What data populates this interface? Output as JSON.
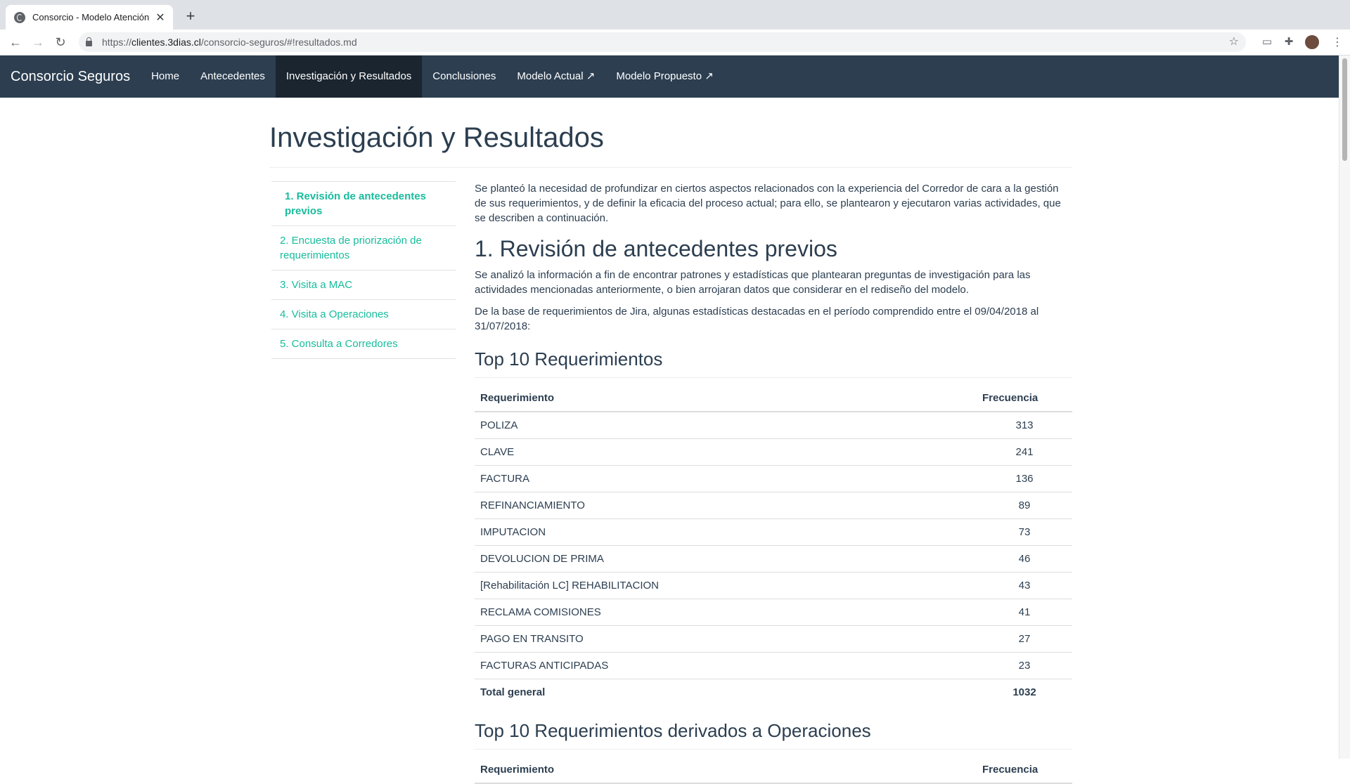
{
  "browser": {
    "tab_title": "Consorcio - Modelo Atención C",
    "url_prefix": "https://",
    "url_host": "clientes.3dias.cl",
    "url_path": "/consorcio-seguros/#!resultados.md"
  },
  "navbar": {
    "brand": "Consorcio Seguros",
    "items": [
      {
        "label": "Home"
      },
      {
        "label": "Antecedentes"
      },
      {
        "label": "Investigación y Resultados"
      },
      {
        "label": "Conclusiones"
      },
      {
        "label": "Modelo Actual ↗"
      },
      {
        "label": "Modelo Propuesto ↗"
      }
    ]
  },
  "page": {
    "title": "Investigación y Resultados"
  },
  "toc": [
    {
      "label": "1. Revisión de antecedentes previos"
    },
    {
      "label": "2. Encuesta de priorización de requerimientos"
    },
    {
      "label": "3. Visita a MAC"
    },
    {
      "label": "4. Visita a Operaciones"
    },
    {
      "label": "5. Consulta a Corredores"
    }
  ],
  "content": {
    "intro": "Se planteó la necesidad de profundizar en ciertos aspectos relacionados con la experiencia del Corredor de cara a la gestión de sus requerimientos, y de definir la eficacia del proceso actual; para ello, se plantearon y ejecutaron varias actividades, que se describen a continuación.",
    "section1_heading": "1. Revisión de antecedentes previos",
    "section1_p1": "Se analizó la información a fin de encontrar patrones y estadísticas que plantearan preguntas de investigación para las actividades mencionadas anteriormente, o bien arrojaran datos que considerar en el rediseño del modelo.",
    "section1_p2": "De la base de requerimientos de Jira, algunas estadísticas destacadas en el período comprendido entre el 09/04/2018 al 31/07/2018:",
    "table1": {
      "heading": "Top 10 Requerimientos",
      "col1": "Requerimiento",
      "col2": "Frecuencia",
      "rows": [
        {
          "req": "POLIZA",
          "freq": "313"
        },
        {
          "req": "CLAVE",
          "freq": "241"
        },
        {
          "req": "FACTURA",
          "freq": "136"
        },
        {
          "req": "REFINANCIAMIENTO",
          "freq": "89"
        },
        {
          "req": "IMPUTACION",
          "freq": "73"
        },
        {
          "req": "DEVOLUCION DE PRIMA",
          "freq": "46"
        },
        {
          "req": "[Rehabilitación LC] REHABILITACION",
          "freq": "43"
        },
        {
          "req": "RECLAMA COMISIONES",
          "freq": "41"
        },
        {
          "req": "PAGO EN TRANSITO",
          "freq": "27"
        },
        {
          "req": "FACTURAS ANTICIPADAS",
          "freq": "23"
        }
      ],
      "total_label": "Total general",
      "total_value": "1032"
    },
    "table2": {
      "heading": "Top 10 Requerimientos derivados a Operaciones",
      "col1": "Requerimiento",
      "col2": "Frecuencia"
    }
  }
}
